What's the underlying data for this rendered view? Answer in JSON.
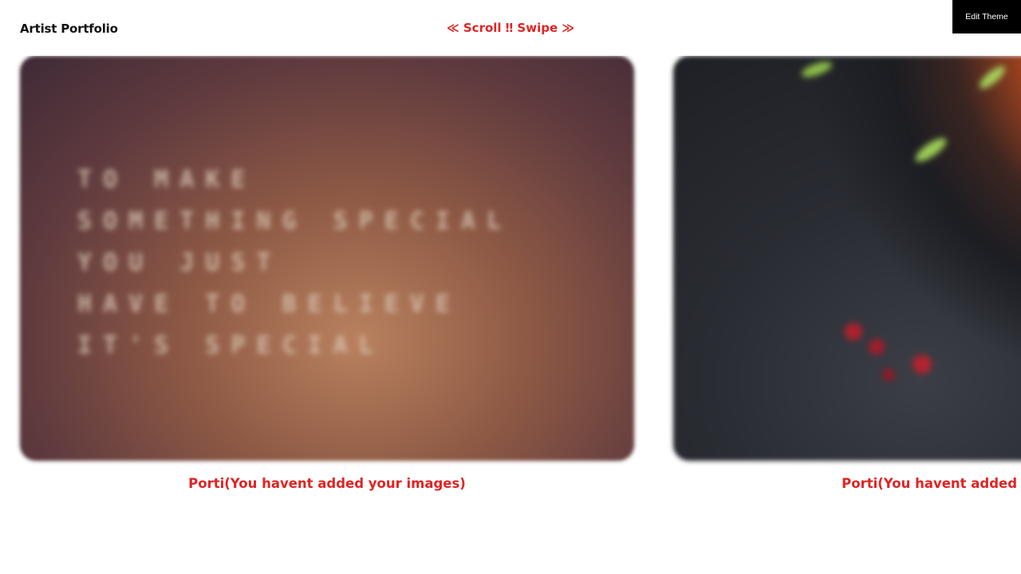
{
  "header": {
    "brand": "Artist Portfolio",
    "scroll_hint": "≪ Scroll ‼ Swipe ≫",
    "edit_theme_label": "Edit Theme"
  },
  "gallery": {
    "items": [
      {
        "caption": "Porti(You havent added your images)",
        "photo_text": "TO MAKE\nSOMETHING SPECIAL\nYOU JUST\nHAVE TO BELIEVE\nIT'S SPECIAL"
      },
      {
        "caption": "Porti(You havent added your images)"
      }
    ]
  },
  "colors": {
    "accent": "#e02424",
    "button_bg": "#000000",
    "text_dark": "#111111"
  }
}
